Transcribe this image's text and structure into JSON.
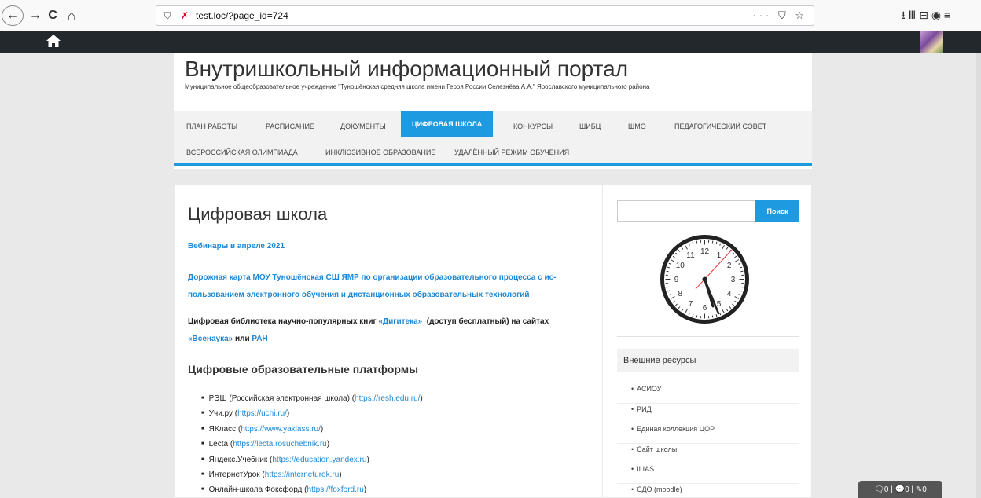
{
  "browser": {
    "url": "test.loc/?page_id=724",
    "nav_back": "←",
    "nav_forward": "→",
    "reload": "C",
    "home": "⌂",
    "url_actions": "··· ⛉ ☆",
    "toolbar": "⭳ Ⅲ ⊟ ◉ ≡"
  },
  "admin_bar": {
    "home_icon": "home-icon"
  },
  "header": {
    "title": "Внутришкольный информационный портал",
    "description": "Муниципальное общеобразовательное учреждение \"Туношёнская средняя школа имени Героя России Селезнёва А.А.\" Ярославского муниципального района"
  },
  "menu": {
    "row1": [
      "ПЛАН РАБОТЫ",
      "РАСПИСАНИЕ",
      "ДОКУМЕНТЫ",
      "ЦИФРОВАЯ ШКОЛА",
      "КОНКУРСЫ",
      "ШИБЦ",
      "ШМО",
      "ПЕДАГОГИЧЕСКИЙ СОВЕТ"
    ],
    "row2": [
      "ВСЕРОССИЙСКАЯ ОЛИМПИАДА",
      "ИНКЛЮЗИВНОЕ ОБРАЗОВАНИЕ",
      "УДАЛЁННЫЙ РЕЖИМ ОБУЧЕНИЯ"
    ]
  },
  "content": {
    "title": "Цифровая школа",
    "webinars": "Вебинары в апреле 2021",
    "roadmap_line1": "Дорожная карта МОУ Туношёнская СШ ЯМР по организации образовательного процесса с ис-",
    "roadmap_line2": "пользованием электронного обучения и дистанционных образовательных технологий",
    "library_text1": "Цифровая библиотека научно-популярных книг ",
    "library_link1": "«Дигитека»",
    "library_text2": "  (доступ бесплатный) на сайтах",
    "library_link2": "«Всенаука»",
    "library_text3": " или ",
    "library_link3": "РАН",
    "platforms_title": "Цифровые образовательные платформы",
    "platforms": [
      {
        "name": "РЭШ (Российская электронная школа) (",
        "url": "https://resh.edu.ru/",
        "end": ")"
      },
      {
        "name": "Учи.ру (",
        "url": "https://uchi.ru/",
        "end": ")"
      },
      {
        "name": "ЯКласс (",
        "url": "https://www.yaklass.ru/",
        "end": ")"
      },
      {
        "name": "Lecta (",
        "url": "https://lecta.rosuchebnik.ru",
        "end": ")"
      },
      {
        "name": "Яндекс.Учебник (",
        "url": "https://education.yandex.ru",
        "end": ")"
      },
      {
        "name": "ИнтернетУрок (",
        "url": "https://interneturok.ru",
        "end": ")"
      },
      {
        "name": "Онлайн-школа Фоксфорд (",
        "url": "https://foxford.ru",
        "end": ")"
      }
    ]
  },
  "sidebar": {
    "search_button": "Поиск",
    "search_value": "",
    "clock_numbers": [
      "12",
      "1",
      "2",
      "3",
      "4",
      "5",
      "6",
      "7",
      "8",
      "9",
      "10",
      "11"
    ],
    "resources_title": "Внешние ресурсы",
    "resources": [
      "АСИОУ",
      "РИД",
      "Единая коллекция ЦОР",
      "Сайт школы",
      "ILIAS",
      "СДО (moodle)"
    ]
  },
  "counters": {
    "text": "🗨0 | 💬0 | ✎0"
  }
}
